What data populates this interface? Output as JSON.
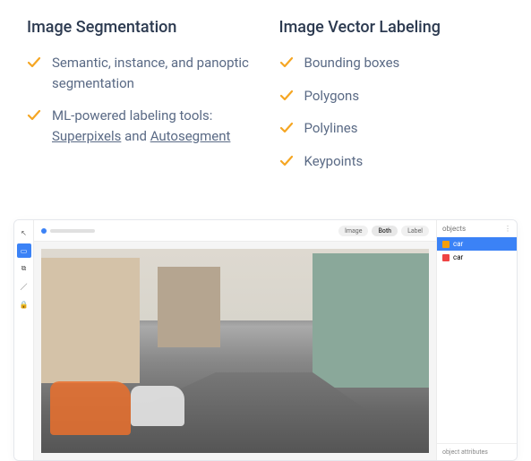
{
  "features": {
    "left": {
      "title": "Image Segmentation",
      "items": [
        {
          "prefix": "Semantic, instance, and panoptic segmentation",
          "link1": "",
          "mid": "",
          "link2": ""
        },
        {
          "prefix": "ML-powered labeling tools: ",
          "link1": "Superpixels",
          "mid": " and ",
          "link2": "Autosegment"
        }
      ]
    },
    "right": {
      "title": "Image Vector Labeling",
      "items": [
        {
          "label": "Bounding boxes"
        },
        {
          "label": "Polygons"
        },
        {
          "label": "Polylines"
        },
        {
          "label": "Keypoints"
        }
      ]
    }
  },
  "app": {
    "tabs": {
      "image": "Image",
      "both": "Both",
      "label": "Label"
    },
    "panel": {
      "header": "objects",
      "items": [
        {
          "label": "car"
        },
        {
          "label": "car"
        }
      ],
      "bottom": "object attributes"
    }
  }
}
